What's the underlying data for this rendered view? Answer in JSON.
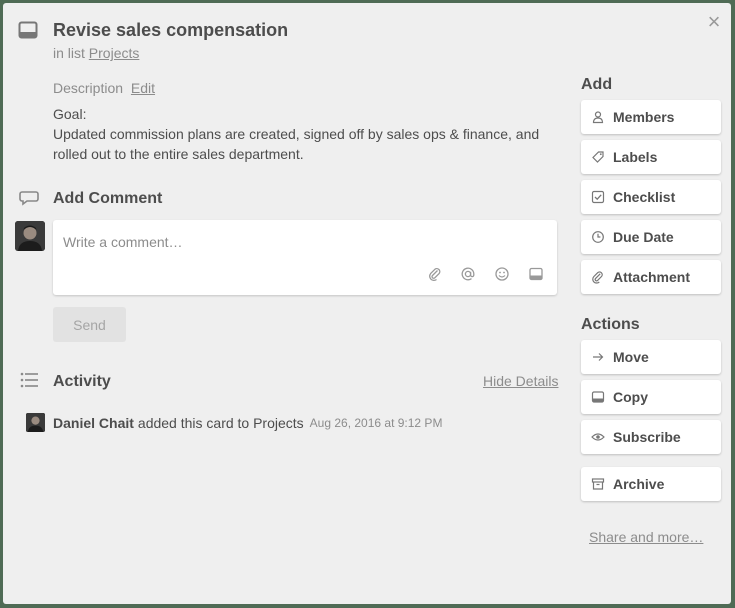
{
  "card": {
    "title": "Revise sales compensation",
    "in_list_prefix": "in list",
    "list_name": "Projects",
    "close_glyph": "×"
  },
  "description": {
    "label": "Description",
    "edit_label": "Edit",
    "line1": "Goal:",
    "line2": "Updated commission plans are created, signed off by sales ops & finance, and rolled out to the entire sales department."
  },
  "comment": {
    "title": "Add Comment",
    "placeholder": "Write a comment…",
    "send_label": "Send",
    "tools": [
      "attachment-icon",
      "mention-icon",
      "emoji-icon",
      "card-icon"
    ]
  },
  "activity": {
    "title": "Activity",
    "hide_details_label": "Hide Details",
    "items": [
      {
        "user": "Daniel Chait",
        "action": "added this card to Projects",
        "time": "Aug 26, 2016 at 9:12 PM"
      }
    ]
  },
  "sidebar": {
    "add_title": "Add",
    "add_items": [
      {
        "label": "Members",
        "icon": "person-icon"
      },
      {
        "label": "Labels",
        "icon": "tag-icon"
      },
      {
        "label": "Checklist",
        "icon": "checkbox-icon"
      },
      {
        "label": "Due Date",
        "icon": "clock-icon"
      },
      {
        "label": "Attachment",
        "icon": "paperclip-icon"
      }
    ],
    "actions_title": "Actions",
    "action_items": [
      {
        "label": "Move",
        "icon": "arrow-right-icon"
      },
      {
        "label": "Copy",
        "icon": "card-icon"
      },
      {
        "label": "Subscribe",
        "icon": "eye-icon"
      },
      {
        "label": "Archive",
        "icon": "archive-icon"
      }
    ],
    "share_label": "Share and more…"
  },
  "colors": {
    "background": "#4f6b55",
    "modal": "#efefef",
    "text": "#4d4d4d",
    "muted": "#8c8c8c"
  }
}
